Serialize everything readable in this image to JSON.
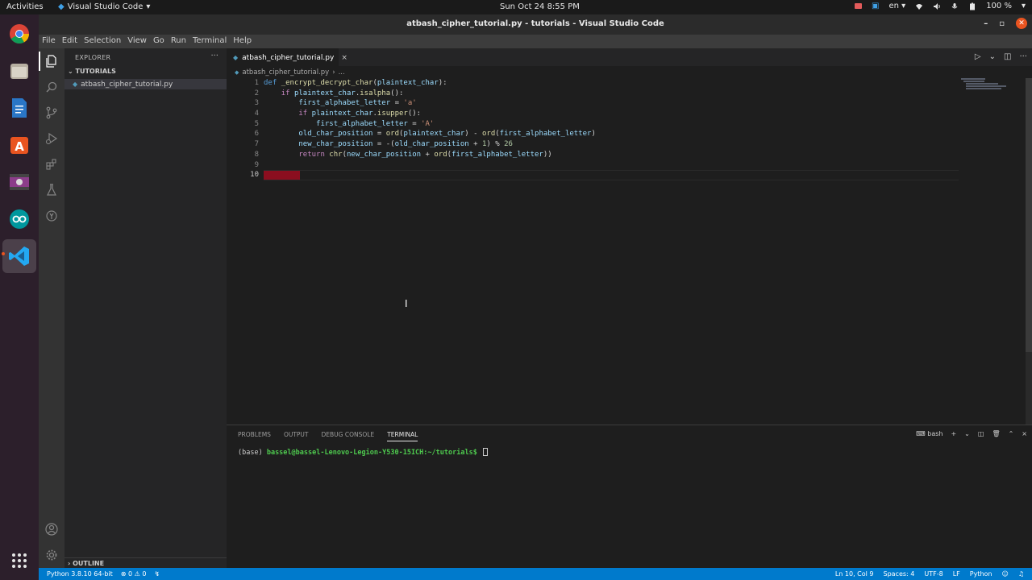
{
  "topbar": {
    "activities": "Activities",
    "app_name": "Visual Studio Code",
    "clock": "Sun Oct 24  8:55 PM",
    "language": "en",
    "battery": "100 %"
  },
  "dock": {
    "items": [
      "chrome-icon",
      "files-icon",
      "libreoffice-writer-icon",
      "software-center-icon",
      "screencast-icon",
      "arduino-icon",
      "vscode-icon",
      "app-grid-icon"
    ]
  },
  "window": {
    "title": "atbash_cipher_tutorial.py - tutorials - Visual Studio Code"
  },
  "menu": {
    "items": [
      "File",
      "Edit",
      "Selection",
      "View",
      "Go",
      "Run",
      "Terminal",
      "Help"
    ]
  },
  "sidebar": {
    "header": "EXPLORER",
    "section": "TUTORIALS",
    "file": "atbash_cipher_tutorial.py",
    "outline": "OUTLINE"
  },
  "editor": {
    "tab_label": "atbash_cipher_tutorial.py",
    "breadcrumb_file": "atbash_cipher_tutorial.py",
    "breadcrumb_more": "...",
    "line_numbers": [
      "1",
      "2",
      "3",
      "4",
      "5",
      "6",
      "7",
      "8",
      "9",
      "10"
    ],
    "active_line": 10
  },
  "panel": {
    "tabs": [
      "PROBLEMS",
      "OUTPUT",
      "DEBUG CONSOLE",
      "TERMINAL"
    ],
    "active_tab": "TERMINAL",
    "shell": "bash",
    "terminal_env": "(base) ",
    "terminal_prompt": "bassel@bassel-Lenovo-Legion-Y530-15ICH:~/tutorials$"
  },
  "statusbar": {
    "python": "Python 3.8.10 64-bit",
    "errors": "0",
    "warnings": "0",
    "position": "Ln 10, Col 9",
    "spaces": "Spaces: 4",
    "encoding": "UTF-8",
    "eol": "LF",
    "language": "Python"
  },
  "colors": {
    "statusbar": "#007acc",
    "ubuntu_accent": "#e95420",
    "whitespace_error": "#8b0e1f"
  }
}
